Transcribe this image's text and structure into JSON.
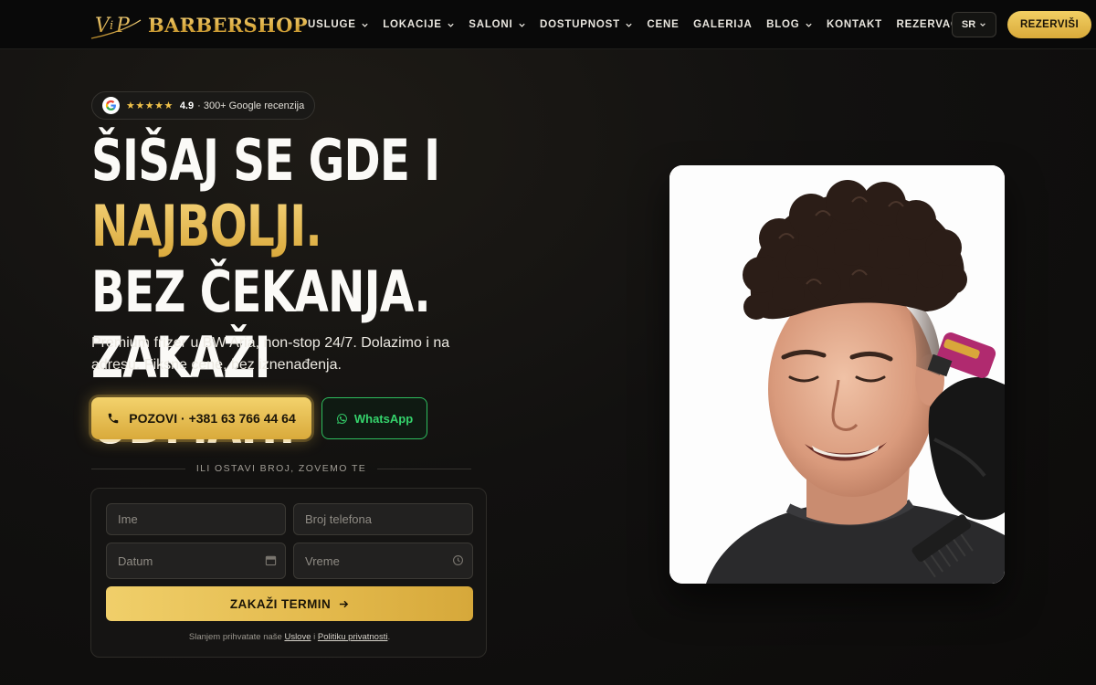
{
  "brand": {
    "logo_mark": "VIP",
    "name": "BARBERSHOP"
  },
  "nav": {
    "items": [
      {
        "label": "USLUGE",
        "dropdown": true
      },
      {
        "label": "LOKACIJE",
        "dropdown": true
      },
      {
        "label": "SALONI",
        "dropdown": true
      },
      {
        "label": "DOSTUPNOST",
        "dropdown": true
      },
      {
        "label": "CENE",
        "dropdown": false
      },
      {
        "label": "GALERIJA",
        "dropdown": false
      },
      {
        "label": "BLOG",
        "dropdown": true
      },
      {
        "label": "KONTAKT",
        "dropdown": false
      },
      {
        "label": "REZERVACIJA",
        "dropdown": false
      }
    ],
    "language": "SR",
    "reserve_label": "REZERVIŠI"
  },
  "hero": {
    "rating": {
      "icon": "google-icon",
      "stars": "★★★★★",
      "value": "4.9",
      "text": "· 300+ Google recenzija"
    },
    "headline": {
      "part1": "ŠIŠAJ SE GDE I ",
      "accent": "NAJBOLJI.",
      "part2": "BEZ ČEKANJA. ZAKAŽI ODMAH!"
    },
    "subtitle": "Premium frizer u BW Aria, non-stop 24/7. Dolazimo i na adresu. Fiksne cene, bez iznenađenja.",
    "call_label": "POZOVI · +381 63 766 44 64",
    "whatsapp_label": "WhatsApp",
    "divider_text": "ILI OSTAVI BROJ, ZOVEMO TE"
  },
  "form": {
    "name_placeholder": "Ime",
    "phone_placeholder": "Broj telefona",
    "date_placeholder": "Datum",
    "time_placeholder": "Vreme",
    "submit_label": "ZAKAŽI TERMIN",
    "terms_prefix": "Slanjem prihvatate naše",
    "terms_link": "Uslove",
    "terms_and": "i",
    "privacy_link": "Politiku privatnosti",
    "terms_suffix": "."
  },
  "colors": {
    "accent_gold": "#e3b94c",
    "whatsapp_green": "#35d36c",
    "background": "#121110"
  }
}
